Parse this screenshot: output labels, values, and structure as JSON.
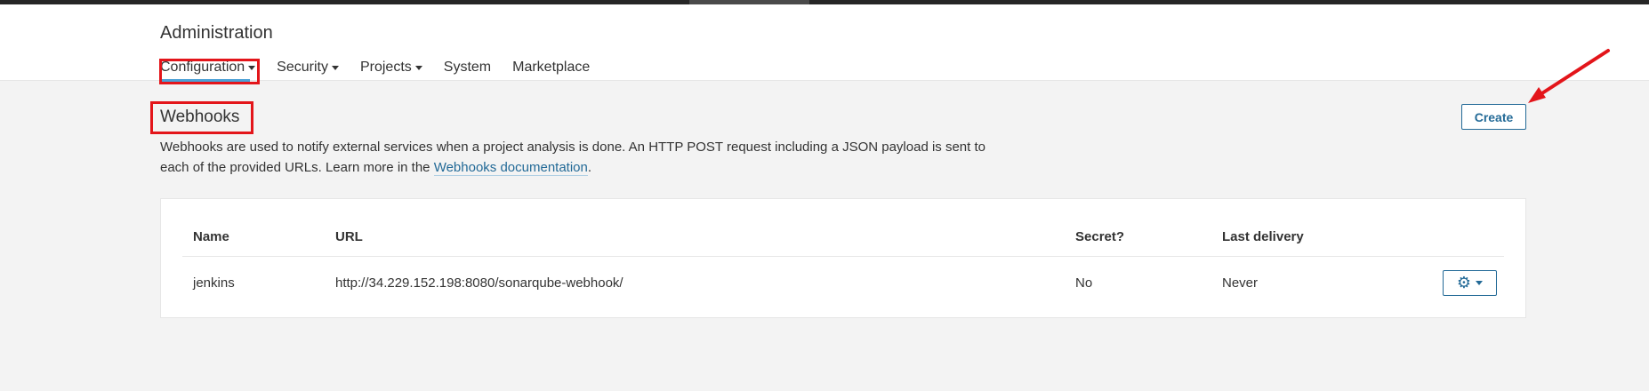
{
  "header": {
    "title": "Administration",
    "nav": [
      {
        "label": "Configuration",
        "has_caret": true,
        "active": true
      },
      {
        "label": "Security",
        "has_caret": true
      },
      {
        "label": "Projects",
        "has_caret": true
      },
      {
        "label": "System",
        "has_caret": false
      },
      {
        "label": "Marketplace",
        "has_caret": false
      }
    ]
  },
  "section": {
    "title": "Webhooks",
    "description_line1": "Webhooks are used to notify external services when a project analysis is done. An HTTP POST request including a JSON payload is sent to",
    "description_line2_prefix": "each of the provided URLs. Learn more in the ",
    "description_link": "Webhooks documentation",
    "description_suffix": ".",
    "create_label": "Create"
  },
  "table": {
    "columns": {
      "name": "Name",
      "url": "URL",
      "secret": "Secret?",
      "last_delivery": "Last delivery"
    },
    "rows": [
      {
        "name": "jenkins",
        "url": "http://34.229.152.198:8080/sonarqube-webhook/",
        "secret": "No",
        "last_delivery": "Never",
        "actions_icon": "gear-icon"
      }
    ]
  },
  "colors": {
    "accent": "#236a97",
    "active_underline": "#4b9fd5",
    "annotation": "#e3151a"
  }
}
